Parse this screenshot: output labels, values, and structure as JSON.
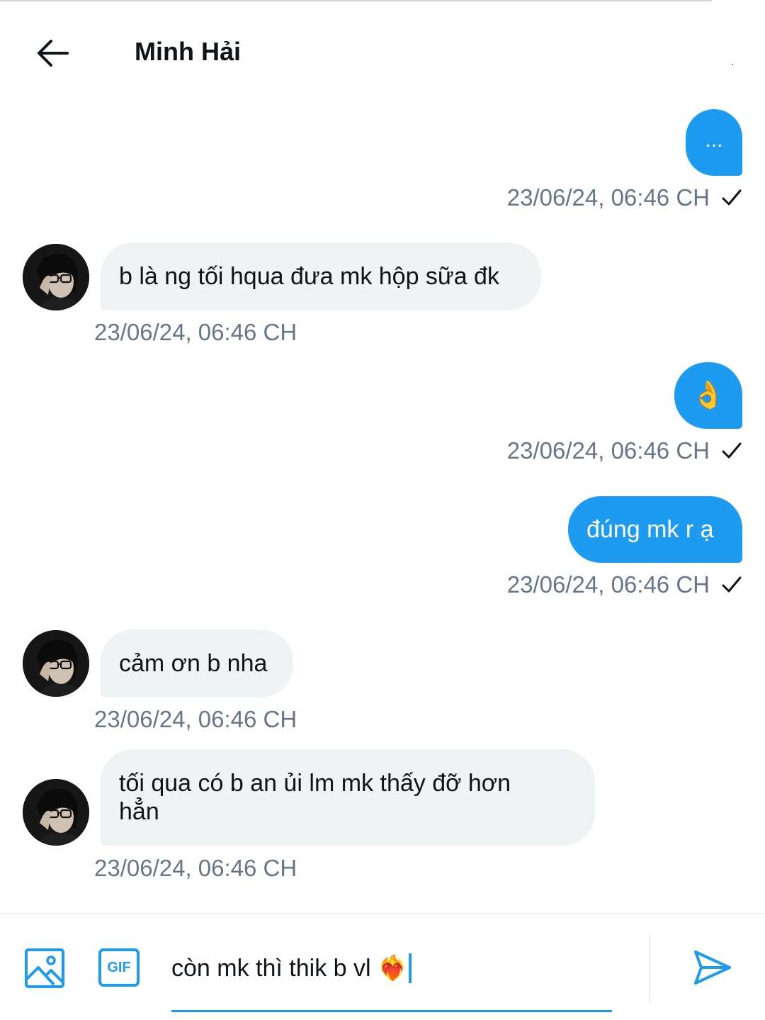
{
  "header": {
    "back_icon": "arrow-left-icon",
    "title": "Minh Hải"
  },
  "messages": [
    {
      "direction": "outgoing",
      "text": "...",
      "timestamp": "23/06/24, 06:46 CH",
      "status_icon": "check-icon"
    },
    {
      "direction": "incoming",
      "text": "b là ng tối hqua đưa mk hộp sữa đk",
      "timestamp": "23/06/24, 06:46 CH"
    },
    {
      "direction": "outgoing",
      "text": "👌",
      "timestamp": "23/06/24, 06:46 CH",
      "status_icon": "check-icon"
    },
    {
      "direction": "outgoing",
      "text": "đúng mk r ạ",
      "timestamp": "23/06/24, 06:46 CH",
      "status_icon": "check-icon"
    },
    {
      "direction": "incoming",
      "text": "cảm ơn b nha",
      "timestamp": "23/06/24, 06:46 CH"
    },
    {
      "direction": "incoming",
      "text": "tối qua có b an ủi lm mk thấy đỡ hơn hẳn",
      "timestamp": "23/06/24, 06:46 CH"
    }
  ],
  "composer": {
    "image_icon": "image-icon",
    "gif_label": "GIF",
    "input_value": "còn mk thì thik b vl ❤️‍🔥",
    "send_icon": "send-icon"
  },
  "colors": {
    "accent": "#1d9bf0",
    "incoming_bubble": "#eff3f4",
    "timestamp": "#66768a"
  }
}
